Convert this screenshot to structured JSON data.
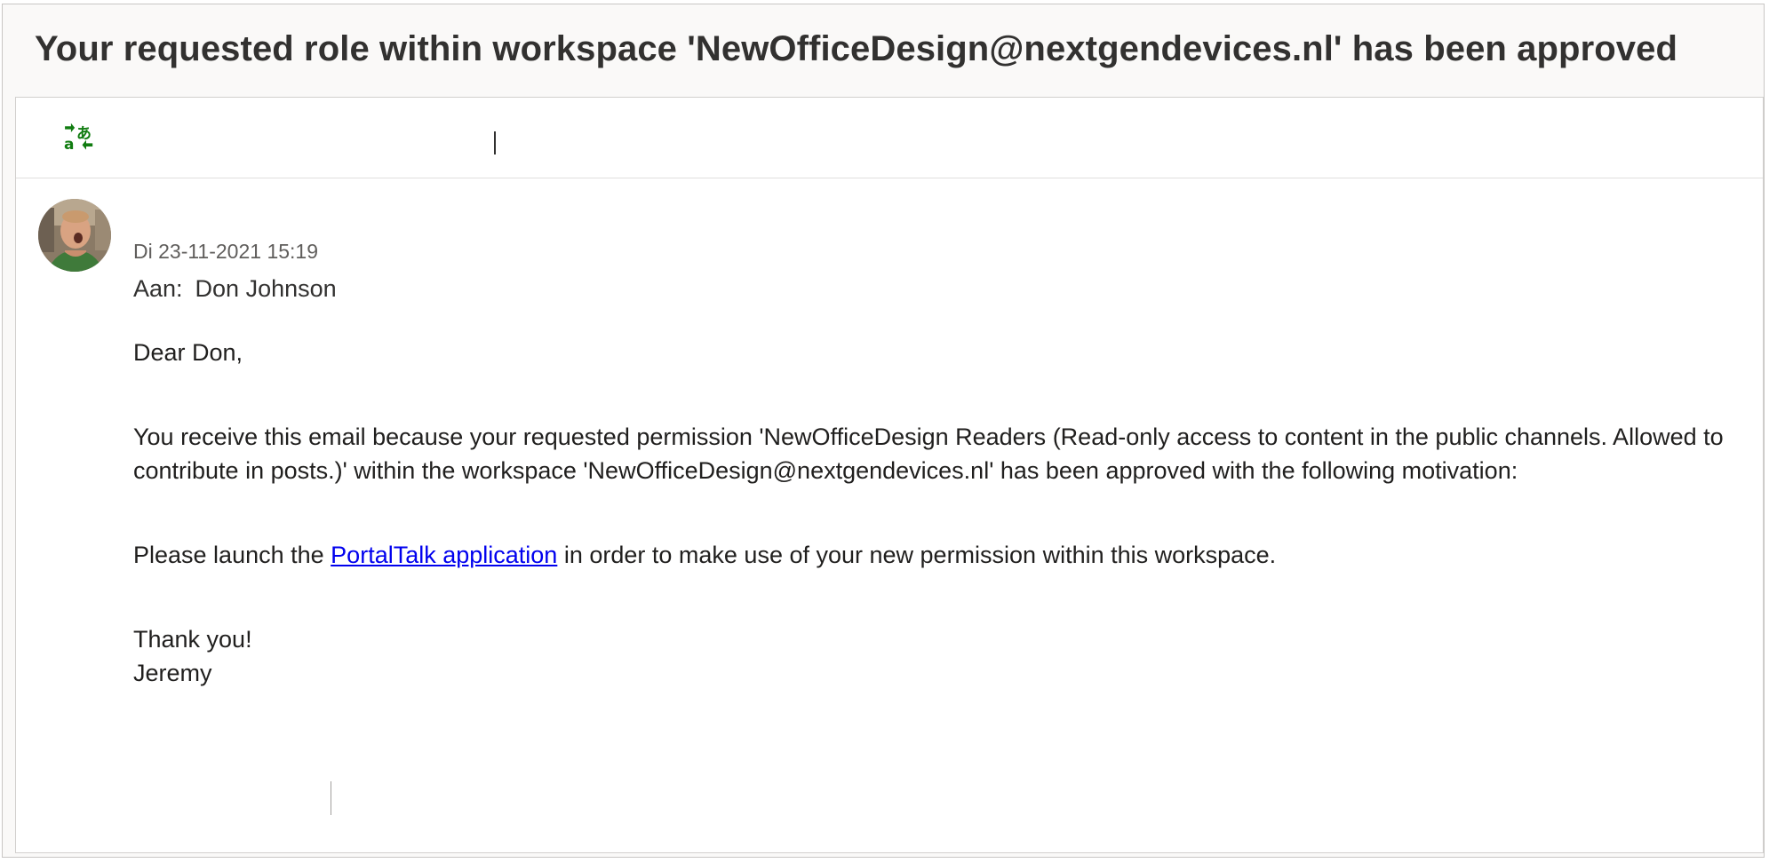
{
  "email": {
    "subject": "Your requested role within workspace 'NewOfficeDesign@nextgendevices.nl' has been approved",
    "date": "Di 23-11-2021 15:19",
    "to_label": "Aan:",
    "to_name": "Don Johnson",
    "greeting": "Dear Don,",
    "paragraph1": "You receive this email because your requested permission 'NewOfficeDesign Readers (Read-only access to content in the public channels. Allowed to contribute in posts.)' within the workspace 'NewOfficeDesign@nextgendevices.nl' has been approved with the following motivation:",
    "paragraph2_before": "Please launch the ",
    "paragraph2_link": "PortalTalk application",
    "paragraph2_after": " in order to make use of your new permission within this workspace.",
    "closing": "Thank you!",
    "signature": "Jeremy"
  },
  "toolbar": {
    "translate_icon": "translate-icon"
  },
  "colors": {
    "translate_icon": "#107c10",
    "link": "#0000ee"
  }
}
